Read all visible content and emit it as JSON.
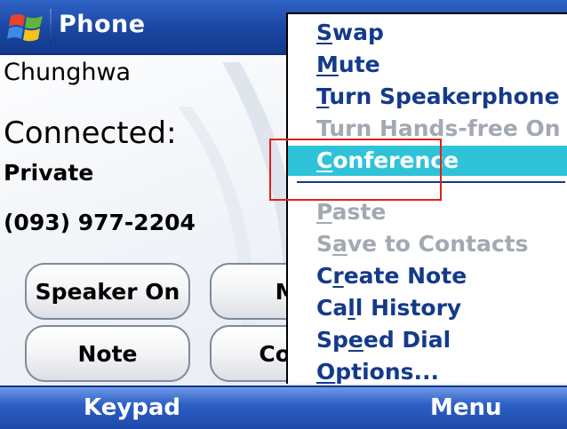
{
  "title_bar": {
    "app_title": "Phone",
    "start_icon": "windows-flag-icon"
  },
  "call": {
    "carrier": "Chunghwa",
    "status": "Connected:",
    "caller": "Private",
    "number": "(093) 977-2204"
  },
  "buttons": {
    "speaker_on": "Speaker On",
    "mute_partial": "Mu",
    "note": "Note",
    "contacts_partial": "Cont"
  },
  "menu": {
    "items": [
      {
        "mnemonic": "S",
        "rest": "wap",
        "state": "enabled"
      },
      {
        "mnemonic": "M",
        "rest": "ute",
        "state": "enabled"
      },
      {
        "mnemonic": "T",
        "rest": "urn Speakerphone On",
        "state": "enabled"
      },
      {
        "pre": "T",
        "mnemonic": "u",
        "rest": "rn Hands-free On",
        "state": "disabled"
      },
      {
        "mnemonic": "C",
        "rest": "onference",
        "state": "selected"
      },
      {
        "mnemonic": "P",
        "rest": "aste",
        "state": "disabled"
      },
      {
        "pre": "S",
        "mnemonic": "a",
        "rest": "ve to Contacts",
        "state": "disabled"
      },
      {
        "pre": "C",
        "mnemonic": "r",
        "rest": "eate Note",
        "state": "enabled"
      },
      {
        "pre": "Ca",
        "mnemonic": "l",
        "rest": "l History",
        "state": "enabled"
      },
      {
        "pre": "Sp",
        "mnemonic": "e",
        "rest": "ed Dial",
        "state": "enabled"
      },
      {
        "mnemonic": "O",
        "rest": "ptions...",
        "state": "enabled"
      }
    ]
  },
  "softkeys": {
    "left": "Keypad",
    "right": "Menu"
  },
  "colors": {
    "titlebar": "#1a46a2",
    "menu_text": "#143a8a",
    "selected_bg": "#2ec3d9",
    "disabled_text": "#a3a9b2",
    "highlight_box": "#e0201c"
  }
}
